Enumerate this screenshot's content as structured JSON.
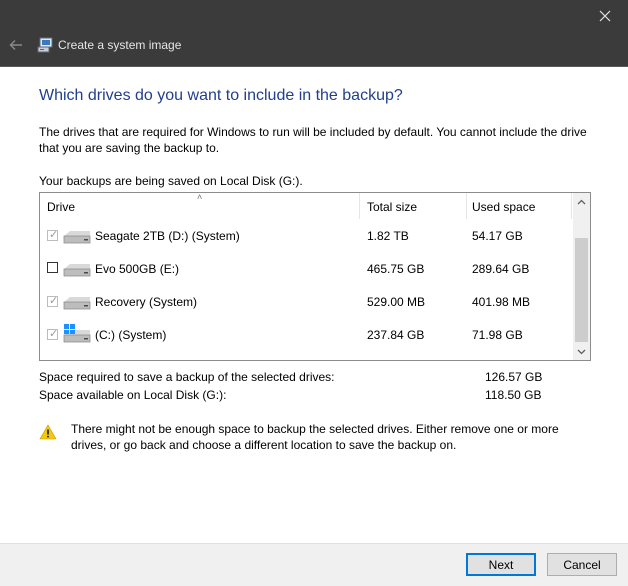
{
  "window": {
    "title": "Create a system image",
    "close_icon": "close-icon",
    "back_icon": "back-arrow-icon"
  },
  "main": {
    "heading": "Which drives do you want to include in the backup?",
    "description": "The drives that are required for Windows to run will be included by default. You cannot include the drive that you are saving the backup to.",
    "saved_to": "Your backups are being saved on Local Disk (G:)."
  },
  "drives_table": {
    "columns": [
      "Drive",
      "Total size",
      "Used space"
    ],
    "rows": [
      {
        "name": "Seagate 2TB (D:) (System)",
        "total": "1.82 TB",
        "used": "54.17 GB",
        "checked": true,
        "enabled": false,
        "icon": "hard-drive-icon"
      },
      {
        "name": "Evo 500GB (E:)",
        "total": "465.75 GB",
        "used": "289.64 GB",
        "checked": false,
        "enabled": true,
        "icon": "hard-drive-icon"
      },
      {
        "name": "Recovery (System)",
        "total": "529.00 MB",
        "used": "401.98 MB",
        "checked": true,
        "enabled": false,
        "icon": "hard-drive-icon"
      },
      {
        "name": "(C:) (System)",
        "total": "237.84 GB",
        "used": "71.98 GB",
        "checked": true,
        "enabled": false,
        "icon": "windows-drive-icon"
      }
    ]
  },
  "summary": {
    "required_label": "Space required to save a backup of the selected drives:",
    "required_value": "126.57 GB",
    "available_label": "Space available on Local Disk (G:):",
    "available_value": "118.50 GB"
  },
  "warning": {
    "icon": "warning-icon",
    "text": "There might not be enough space to backup the selected drives. Either remove one or more drives, or go back and choose a different location to save the backup on."
  },
  "buttons": {
    "next": "Next",
    "cancel": "Cancel"
  },
  "colors": {
    "titlebar": "#3b3b3b",
    "heading": "#203f8e",
    "accent": "#0078d7",
    "warning": "#f2c811"
  }
}
